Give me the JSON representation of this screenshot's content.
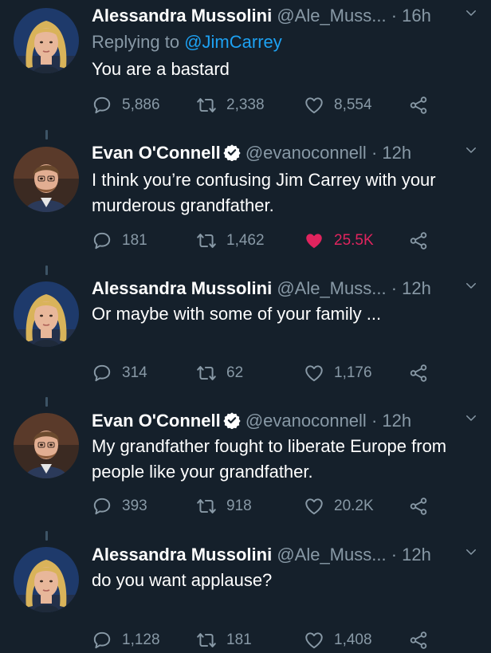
{
  "tweets": [
    {
      "name": "Alessandra Mussolini",
      "handle": "@Ale_Muss...",
      "time": "16h",
      "verified": false,
      "replying_prefix": "Replying to",
      "replying_to": "@JimCarrey",
      "text": "You are a bastard",
      "replies": "5,886",
      "retweets": "2,338",
      "likes": "8,554",
      "liked": false
    },
    {
      "name": "Evan O'Connell",
      "handle": "@evanoconnell",
      "time": "12h",
      "verified": true,
      "text": "I think you’re confusing Jim Carrey with your murderous grandfather.",
      "replies": "181",
      "retweets": "1,462",
      "likes": "25.5K",
      "liked": true
    },
    {
      "name": "Alessandra Mussolini",
      "handle": "@Ale_Muss...",
      "time": "12h",
      "verified": false,
      "text": "Or maybe with some of your family ...",
      "replies": "314",
      "retweets": "62",
      "likes": "1,176",
      "liked": false
    },
    {
      "name": "Evan O'Connell",
      "handle": "@evanoconnell",
      "time": "12h",
      "verified": true,
      "text": "My grandfather fought to liberate Europe from people like your grandfather.",
      "replies": "393",
      "retweets": "918",
      "likes": "20.2K",
      "liked": false
    },
    {
      "name": "Alessandra Mussolini",
      "handle": "@Ale_Muss...",
      "time": "12h",
      "verified": false,
      "text": "do you want applause?",
      "replies": "1,128",
      "retweets": "181",
      "likes": "1,408",
      "liked": false
    }
  ],
  "icons": {
    "reply": "reply-icon",
    "retweet": "retweet-icon",
    "like": "heart-icon",
    "share": "share-icon",
    "caret": "chevron-down-icon",
    "verified": "verified-badge-icon"
  },
  "colors": {
    "background": "#15202b",
    "muted": "#8899a6",
    "link": "#1da1f2",
    "like": "#e0245e",
    "verified": "#ffffff"
  }
}
